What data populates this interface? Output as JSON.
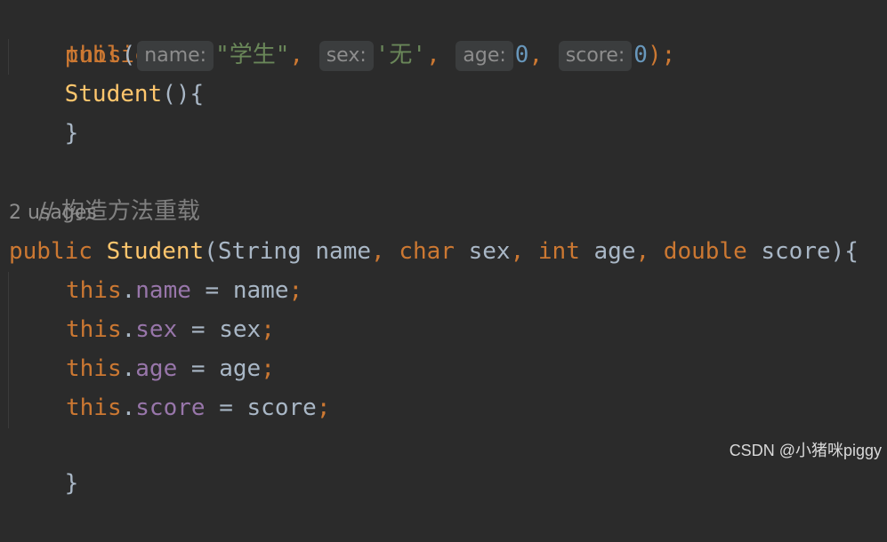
{
  "code": {
    "line1": {
      "kw": "public",
      "name": "Student",
      "tail": "(){"
    },
    "line2": {
      "this_kw": "this",
      "open": "(",
      "hint_name": "name:",
      "arg_name": "\"学生\"",
      "sep1": ",",
      "hint_sex": "sex:",
      "arg_sex": "'无'",
      "sep2": ",",
      "hint_age": "age:",
      "arg_age": "0",
      "sep3": ",",
      "hint_score": "score:",
      "arg_score": "0",
      "close": ");"
    },
    "line3": "}",
    "comment": "// 构造方法重载",
    "usages": "2 usages",
    "line6": {
      "kw": "public",
      "name": "Student",
      "open": "(",
      "t1": "String",
      "p1": "name",
      "c1": ",",
      "t2": "char",
      "p2": "sex",
      "c2": ",",
      "t3": "int",
      "p3": "age",
      "c3": ",",
      "t4": "double",
      "p4": "score",
      "close": "){"
    },
    "assignments": [
      {
        "this": "this",
        "dot": ".",
        "field": "name",
        "eq": " = ",
        "value": "name",
        "semi": ";"
      },
      {
        "this": "this",
        "dot": ".",
        "field": "sex",
        "eq": " = ",
        "value": "sex",
        "semi": ";"
      },
      {
        "this": "this",
        "dot": ".",
        "field": "age",
        "eq": " = ",
        "value": "age",
        "semi": ";"
      },
      {
        "this": "this",
        "dot": ".",
        "field": "score",
        "eq": " = ",
        "value": "score",
        "semi": ";"
      }
    ],
    "closing": "}"
  },
  "watermark": "CSDN @小猪咪piggy",
  "colors": {
    "background": "#2b2b2b",
    "keyword": "#cc7832",
    "method": "#ffc66d",
    "string": "#6a8759",
    "number": "#6897bb",
    "field": "#9876aa",
    "comment": "#808080",
    "text": "#a9b7c6"
  }
}
